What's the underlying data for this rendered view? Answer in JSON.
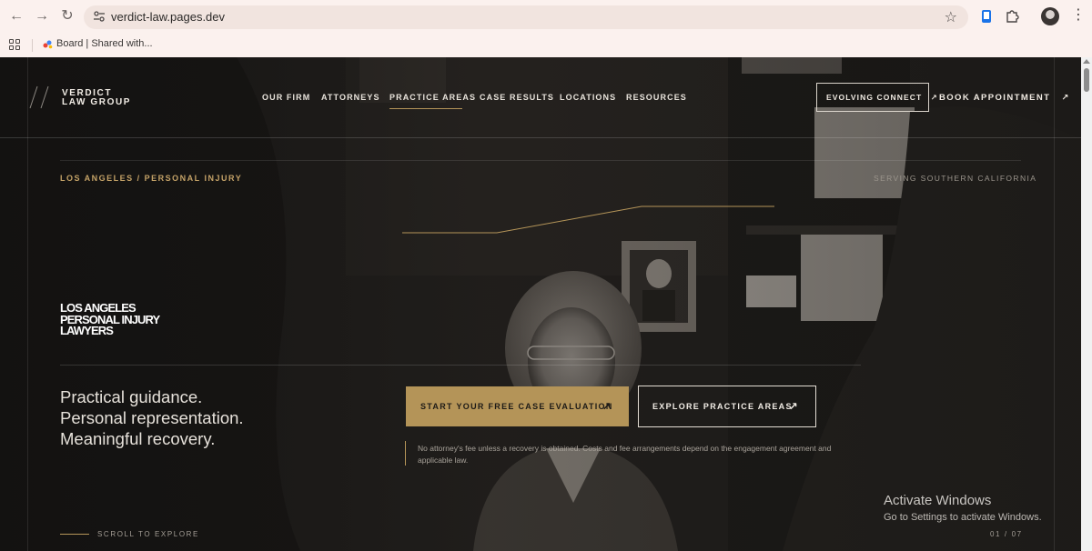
{
  "browser": {
    "url": "verdict-law.pages.dev",
    "bookmark_label": "Board | Shared with..."
  },
  "site": {
    "logo_line1": "VERDICT",
    "logo_line2": "LAW GROUP",
    "nav": [
      {
        "label": "OUR FIRM"
      },
      {
        "label": "ATTORNEYS"
      },
      {
        "label": "PRACTICE AREAS",
        "active": true
      },
      {
        "label": "CASE RESULTS"
      },
      {
        "label": "LOCATIONS"
      },
      {
        "label": "RESOURCES"
      }
    ],
    "cta_outline": "EVOLVING CONNECT",
    "cta_book": "BOOK APPOINTMENT",
    "arrow": "↗"
  },
  "hero": {
    "breadcrumb": "LOS ANGELES / PERSONAL INJURY",
    "serving": "SERVING SOUTHERN CALIFORNIA",
    "heading_line1": "LOS ANGELES",
    "heading_line2": "PERSONAL INJURY",
    "heading_line3": "LAWYERS",
    "tagline_line1": "Practical guidance.",
    "tagline_line2": "Personal representation.",
    "tagline_line3": "Meaningful recovery.",
    "primary_cta": "START YOUR FREE CASE EVALUATION",
    "secondary_cta": "EXPLORE PRACTICE AREAS",
    "disclaimer": "No attorney's fee unless a recovery is obtained. Costs and fee arrangements depend on the engagement agreement and applicable law.",
    "scroll_hint": "SCROLL TO EXPLORE",
    "slide_counter": "01 / 07"
  },
  "os_overlay": {
    "title": "Activate Windows",
    "subtitle": "Go to Settings to activate Windows."
  },
  "colors": {
    "accent_gold": "#b49458",
    "background": "#1a1816",
    "chrome_bg": "#fbf1ee"
  }
}
